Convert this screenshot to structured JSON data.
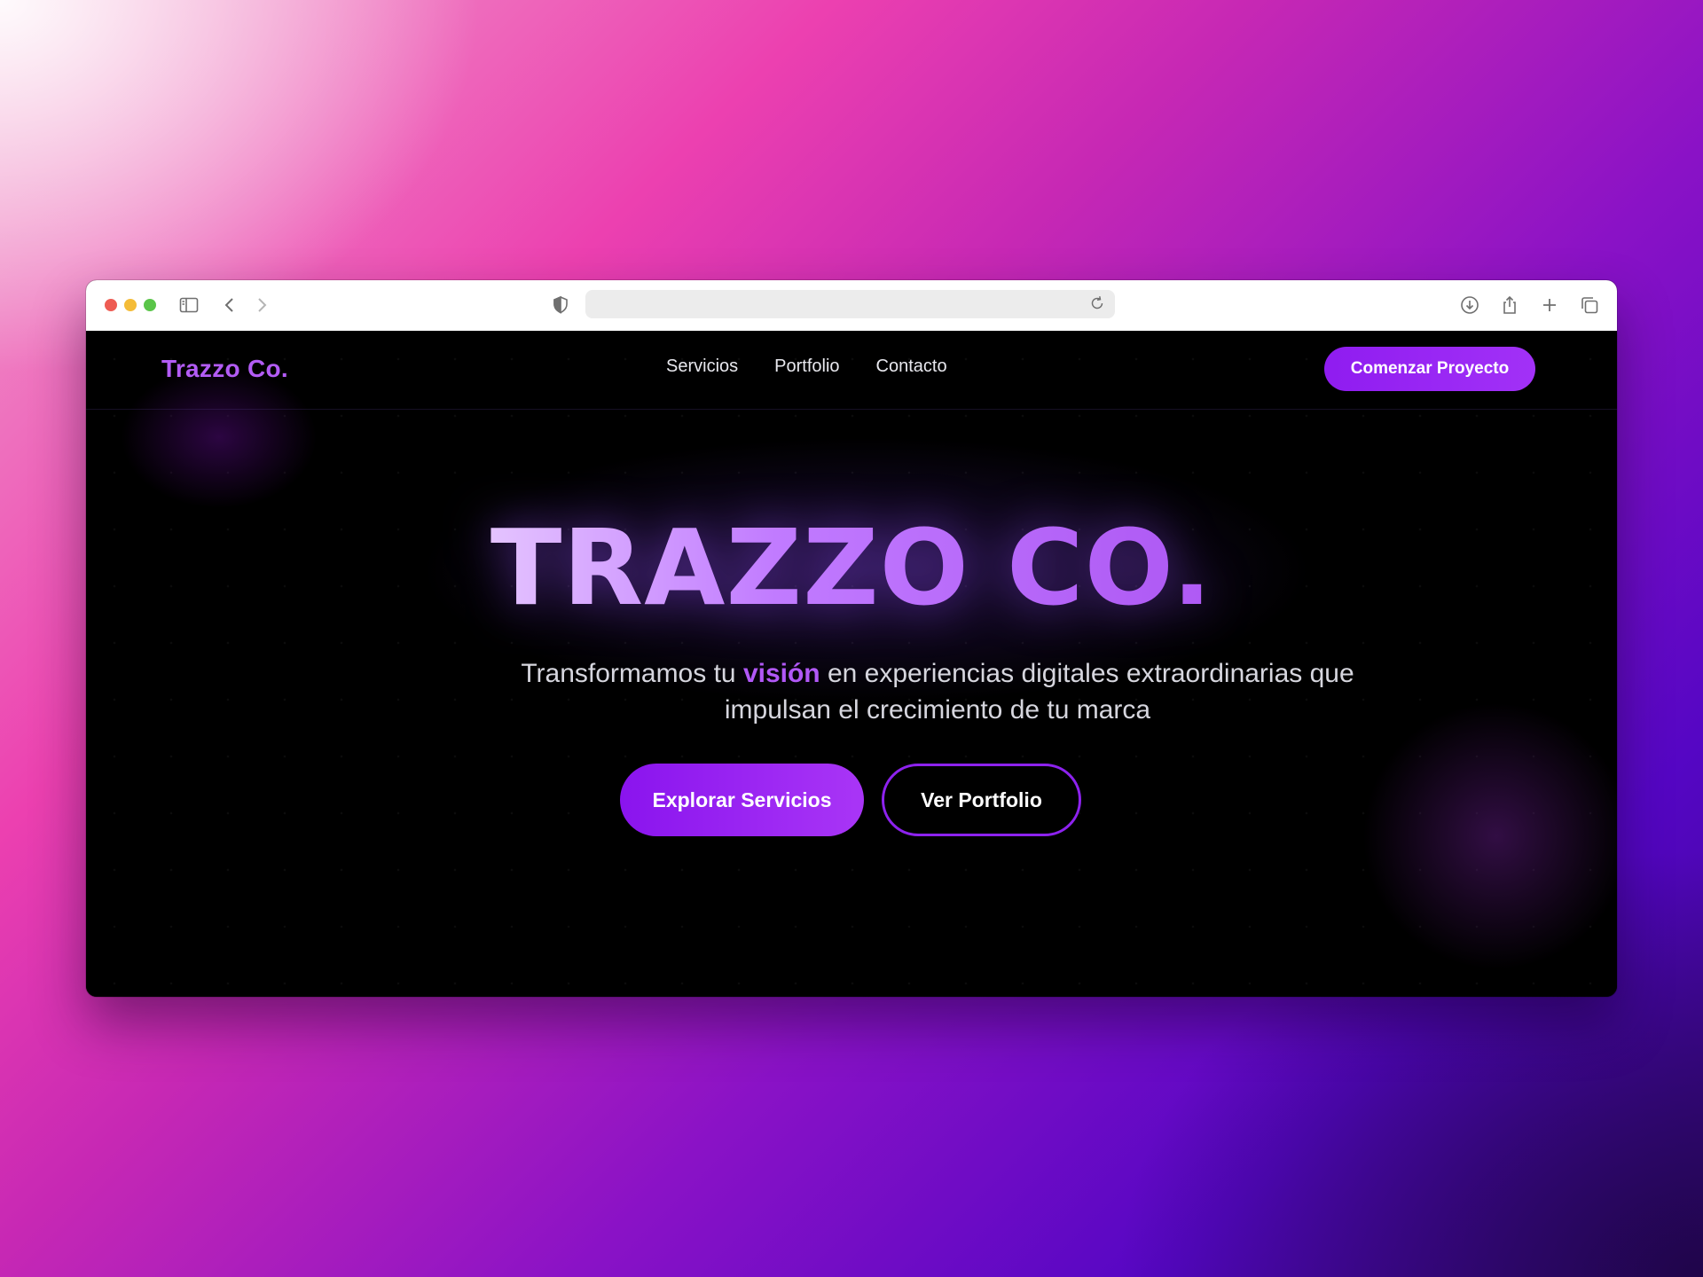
{
  "browser": {
    "url": "",
    "icons": [
      "sidebar-icon",
      "back-icon",
      "forward-icon",
      "shield-icon",
      "reload-icon",
      "download-icon",
      "share-icon",
      "new-tab-icon",
      "tabs-icon"
    ]
  },
  "site": {
    "brand": "Trazzo Co.",
    "nav": [
      "Servicios",
      "Portfolio",
      "Contacto"
    ],
    "cta_label": "Comenzar Proyecto",
    "hero": {
      "title": "TRAZZO CO.",
      "subtitle_before": "Transformamos tu ",
      "subtitle_highlight": "visión",
      "subtitle_after": " en experiencias digitales extraordinarias que impulsan el crecimiento de tu marca",
      "primary_button": "Explorar Servicios",
      "secondary_button": "Ver Portfolio"
    }
  },
  "colors": {
    "accent": "#9a2cf4",
    "brand_text": "#b35cf5",
    "background": "#000000"
  }
}
